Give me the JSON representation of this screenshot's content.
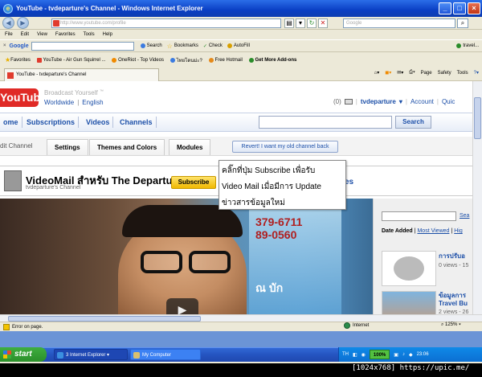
{
  "window": {
    "title": "YouTube - tvdeparture's Channel - Windows Internet Explorer"
  },
  "address_bar": {
    "url": "http://www.youtube.com/profile",
    "search_placeholder": "Google"
  },
  "menu": [
    "File",
    "Edit",
    "View",
    "Favorites",
    "Tools",
    "Help"
  ],
  "google_toolbar": {
    "label": "Google",
    "items": [
      "Search",
      "Bookmarks",
      "Check",
      "AutoFill"
    ],
    "right_label": "travel..."
  },
  "favorites_bar": {
    "label": "Favorites",
    "items": [
      "YouTube - Air Gun Squirrel ...",
      "OneRiot - Top Videos",
      "ไทยโดนม่ะ?",
      "Free Hotmail",
      "Get More Add-ons"
    ]
  },
  "tab": {
    "label": "YouTube - tvdeparture's Channel"
  },
  "command_bar": [
    "Page",
    "Safety",
    "Tools"
  ],
  "youtube": {
    "logo": "You",
    "logo_tube": "Tube",
    "broadcast": "Broadcast Yourself",
    "tm": "™",
    "worldwide": "Worldwide",
    "language": "English",
    "mail_count": "(0)",
    "username": "tvdeparture",
    "account": "Account",
    "quicklist": "Quic",
    "nav": [
      "ome",
      "Subscriptions",
      "Videos",
      "Channels"
    ],
    "search_button": "Search",
    "edit_channel": "dit Channel",
    "edit_tabs": [
      "Settings",
      "Themes and Colors",
      "Modules"
    ],
    "revert": "Revert! I want my old channel back",
    "channel_title": "VideoMail สำหรับ The Departure",
    "channel_sub": "tvdeparture's Channel",
    "subscribe": "Subscribe",
    "es_frag": "es",
    "tooltip": [
      "คลิ๊กที่ปุ่ม Subscribe เพื่อรับ",
      "Video Mail เมื่อมีการ Update",
      "ข่าวสารข้อมูลใหม่"
    ],
    "poster_text": [
      "379-6711",
      "89-0560",
      "ณ บัก"
    ],
    "side_search": "Sea",
    "sort": {
      "label": "Date Added",
      "sep": "|",
      "most_viewed": "Most Viewed",
      "highest": "Hig"
    },
    "side_videos": [
      {
        "title": "การปรับอ",
        "views": "0 views - 15"
      },
      {
        "title": "ข้อมูลการ Travel Bu",
        "views": "2 views - 26"
      }
    ]
  },
  "status": {
    "left": "Error on page.",
    "zone": "Internet",
    "zoom": "125%"
  },
  "taskbar": {
    "start": "start",
    "tasks": [
      "3 Internet Explorer",
      "My Computer"
    ],
    "lang": "TH",
    "zoom": "100%",
    "time": "23:06"
  },
  "watermark": "[1024x768] https://upic.me/"
}
